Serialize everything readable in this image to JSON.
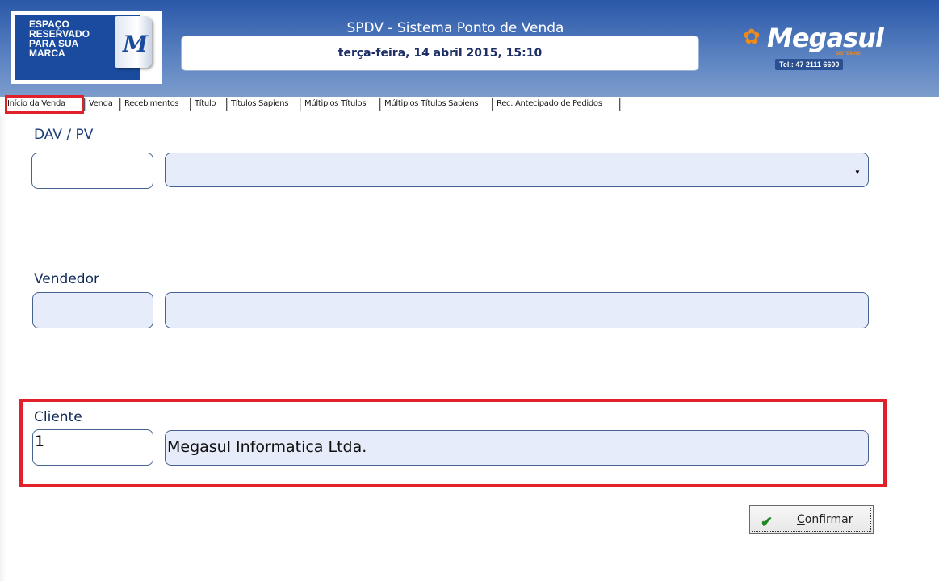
{
  "header": {
    "brand_text": "ESPAÇO\nRESERVADO\nPARA SUA\nMARCA",
    "brand_book_letter": "M",
    "app_title": "SPDV - Sistema Ponto de Venda",
    "datetime": "terça-feira, 14 abril 2015, 15:10",
    "logo": {
      "name": "Megasul",
      "sub": "SISTEMAS",
      "tel": "Tel.: 47 2111 6600"
    }
  },
  "tabs": [
    {
      "label": "Início da Venda",
      "active": true
    },
    {
      "label": "Venda"
    },
    {
      "label": "Recebimentos"
    },
    {
      "label": "Título"
    },
    {
      "label": "Títulos Sapiens"
    },
    {
      "label": "Múltiplos Títulos"
    },
    {
      "label": "Múltiplos Títulos Sapiens"
    },
    {
      "label": "Rec. Antecipado de Pedidos"
    }
  ],
  "form": {
    "dav": {
      "label": "DAV / PV",
      "code": "",
      "selected": ""
    },
    "vendedor": {
      "label": "Vendedor",
      "code": "",
      "name": ""
    },
    "cliente": {
      "label": "Cliente",
      "code": "1",
      "name": "Megasul Informatica Ltda."
    }
  },
  "actions": {
    "confirm_label": "Confirmar"
  },
  "colors": {
    "header_top": "#2a57a8",
    "highlight": "#e0212b",
    "field_border": "#46628f",
    "field_fill": "#e6ecfa"
  }
}
